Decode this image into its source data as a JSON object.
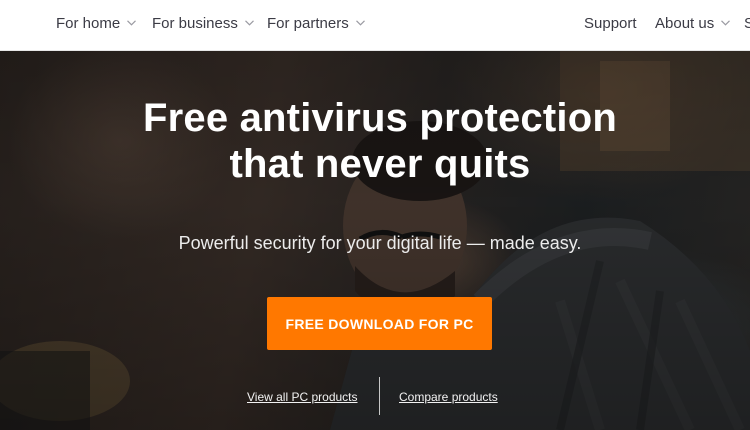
{
  "nav": {
    "left": [
      {
        "label": "For home",
        "icon": "chevron-down-icon"
      },
      {
        "label": "For business",
        "icon": "chevron-down-icon"
      },
      {
        "label": "For partners",
        "icon": "chevron-down-icon"
      }
    ],
    "right": [
      {
        "label": "Support"
      },
      {
        "label": "About us",
        "icon": "chevron-down-icon"
      },
      {
        "label": "S"
      }
    ]
  },
  "hero": {
    "headline_line1": "Free antivirus protection",
    "headline_line2": "that never quits",
    "subheadline": "Powerful security for your digital life — made easy.",
    "cta_label": "FREE DOWNLOAD FOR PC",
    "link_view_all": "View all PC products",
    "link_compare": "Compare products"
  },
  "colors": {
    "accent": "#ff7800",
    "nav_text": "#3b3b45"
  }
}
